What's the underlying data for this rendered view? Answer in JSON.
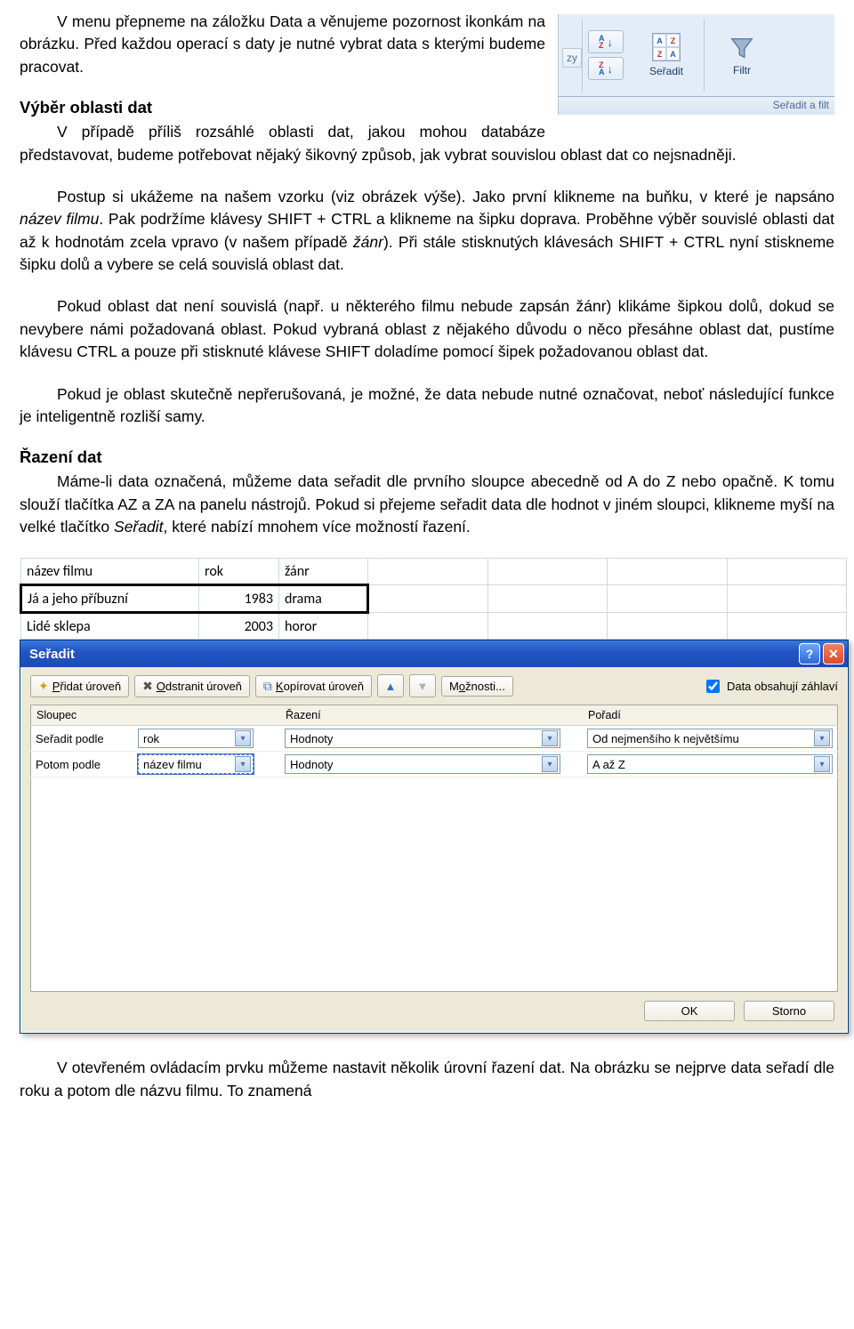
{
  "ribbon": {
    "btn_sort": "Seřadit",
    "btn_filter": "Filtr",
    "group_label": "Seřadit a filt",
    "tab_stub": "zy"
  },
  "text": {
    "p1": "V menu přepneme na záložku Data a věnujeme pozornost ikonkám na obrázku. Před každou operací s daty je nutné vybrat data s kterými budeme pracovat.",
    "h1": "Výběr oblasti dat",
    "p2": "V případě příliš rozsáhlé oblasti dat, jakou mohou databáze představovat, budeme potřebovat nějaký šikovný způsob, jak vybrat souvislou oblast dat co nejsnadněji.",
    "p3a": "Postup si ukážeme na našem vzorku (viz obrázek výše). Jako první klikneme na buňku, v které je napsáno ",
    "p3i": "název filmu",
    "p3b": ". Pak podržíme klávesy SHIFT + CTRL a klikneme na šipku doprava. Proběhne výběr souvislé oblasti dat až k hodnotám zcela vpravo (v našem případě ",
    "p3i2": "žánr",
    "p3c": "). Při stále stisknutých klávesách SHIFT + CTRL nyní stiskneme šipku dolů a vybere se celá souvislá oblast dat.",
    "p4": "Pokud oblast dat není souvislá (např. u některého filmu nebude zapsán žánr) klikáme šipkou dolů, dokud se nevybere námi požadovaná oblast. Pokud vybraná oblast z nějakého důvodu o něco přesáhne oblast dat, pustíme klávesu CTRL a pouze při stisknuté klávese SHIFT doladíme pomocí šipek požadovanou oblast dat.",
    "p5": "Pokud je oblast skutečně nepřerušovaná, je možné, že data nebude nutné označovat, neboť následující funkce je inteligentně rozliší samy.",
    "h2": "Řazení dat",
    "p6a": "Máme-li data označená, můžeme data seřadit dle prvního sloupce abecedně od A do Z nebo opačně. K tomu slouží tlačítka AZ a ZA na panelu nástrojů. Pokud si přejeme seřadit data dle hodnot v jiném sloupci, klikneme myší na velké tlačítko ",
    "p6i": "Seřadit",
    "p6b": ", které nabízí mnohem více možností řazení.",
    "p7": "V otevřeném ovládacím prvku můžeme nastavit několik úrovní řazení dat. Na obrázku se nejprve data seřadí dle roku a potom dle názvu filmu. To znamená"
  },
  "sheet": {
    "headers": [
      "název filmu",
      "rok",
      "žánr"
    ],
    "rows": [
      [
        "Já a jeho příbuzní",
        "1983",
        "drama"
      ],
      [
        "Lidé sklepa",
        "2003",
        "horor"
      ]
    ]
  },
  "dialog": {
    "title": "Seřadit",
    "add": "Přidat úroveň",
    "remove": "Odstranit úroveň",
    "copy": "Kopírovat úroveň",
    "options": "Možnosti...",
    "headerchk": "Data obsahují záhlaví",
    "col_column": "Sloupec",
    "col_sorton": "Řazení",
    "col_order": "Pořadí",
    "sortby": "Seřadit podle",
    "thenby": "Potom podle",
    "rows": [
      {
        "col": "rok",
        "on": "Hodnoty",
        "ord": "Od nejmenšího k největšímu"
      },
      {
        "col": "název filmu",
        "on": "Hodnoty",
        "ord": "A až Z"
      }
    ],
    "ok": "OK",
    "cancel": "Storno"
  }
}
